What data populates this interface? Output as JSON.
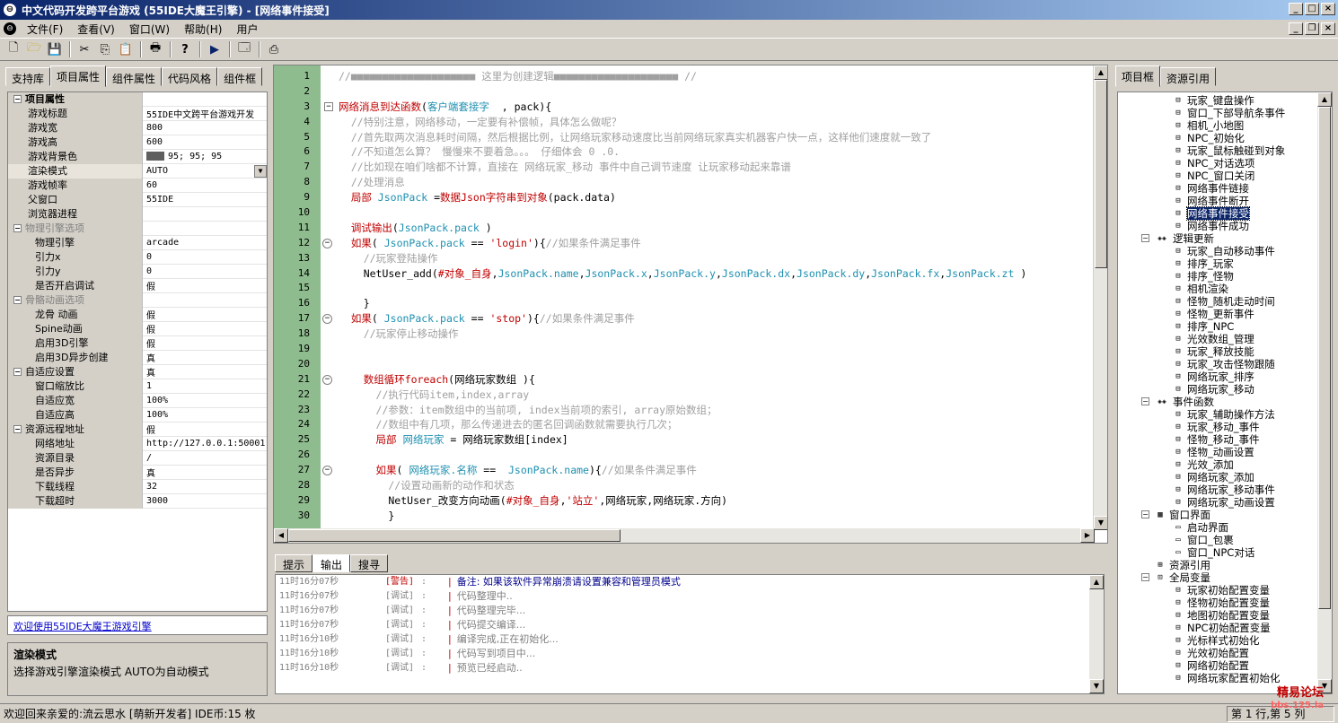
{
  "window": {
    "title": "中文代码开发跨平台游戏 (55IDE大魔王引擎) - [网络事件接受]"
  },
  "menu": [
    "文件(F)",
    "查看(V)",
    "窗口(W)",
    "帮助(H)",
    "用户"
  ],
  "left_panel": {
    "tabs": [
      "支持库",
      "项目属性",
      "组件属性",
      "代码风格",
      "组件框"
    ],
    "active_tab": 1,
    "properties": [
      {
        "name": "项目属性",
        "value": "",
        "kind": "category",
        "expanded": true
      },
      {
        "name": "游戏标题",
        "value": "55IDE中文跨平台游戏开发",
        "kind": "prop",
        "level": 1
      },
      {
        "name": "游戏宽",
        "value": "800",
        "kind": "prop",
        "level": 1
      },
      {
        "name": "游戏高",
        "value": "600",
        "kind": "prop",
        "level": 1
      },
      {
        "name": "游戏背景色",
        "value": "95; 95; 95",
        "kind": "color",
        "level": 1
      },
      {
        "name": "渲染模式",
        "value": "AUTO",
        "kind": "dropdown",
        "level": 1
      },
      {
        "name": "游戏帧率",
        "value": "60",
        "kind": "prop",
        "level": 1
      },
      {
        "name": "父窗口",
        "value": "55IDE",
        "kind": "prop",
        "level": 1
      },
      {
        "name": "浏览器进程",
        "value": "",
        "kind": "prop",
        "level": 1
      },
      {
        "name": "物理引擎选项",
        "value": "",
        "kind": "category-dim",
        "expanded": true
      },
      {
        "name": "物理引擎",
        "value": "arcade",
        "kind": "prop",
        "level": 2
      },
      {
        "name": "引力x",
        "value": "0",
        "kind": "prop",
        "level": 2
      },
      {
        "name": "引力y",
        "value": "0",
        "kind": "prop",
        "level": 2
      },
      {
        "name": "是否开启调试",
        "value": "假",
        "kind": "prop",
        "level": 2
      },
      {
        "name": "骨骼动画选项",
        "value": "",
        "kind": "category-dim",
        "expanded": true
      },
      {
        "name": "龙骨 动画",
        "value": "假",
        "kind": "prop",
        "level": 2
      },
      {
        "name": "Spine动画",
        "value": "假",
        "kind": "prop",
        "level": 2
      },
      {
        "name": "启用3D引擎",
        "value": "假",
        "kind": "prop",
        "level": 2
      },
      {
        "name": "启用3D异步创建",
        "value": "真",
        "kind": "prop",
        "level": 2
      },
      {
        "name": "自适应设置",
        "value": "真",
        "kind": "category-plain",
        "expanded": true
      },
      {
        "name": "窗口缩放比",
        "value": "1",
        "kind": "prop",
        "level": 2
      },
      {
        "name": "自适应宽",
        "value": "100%",
        "kind": "prop",
        "level": 2
      },
      {
        "name": "自适应高",
        "value": "100%",
        "kind": "prop",
        "level": 2
      },
      {
        "name": "资源远程地址",
        "value": "假",
        "kind": "category-plain",
        "expanded": true
      },
      {
        "name": "网络地址",
        "value": "http://127.0.0.1:50001",
        "kind": "prop",
        "level": 2
      },
      {
        "name": "资源目录",
        "value": "/",
        "kind": "prop",
        "level": 2
      },
      {
        "name": "是否异步",
        "value": "真",
        "kind": "prop",
        "level": 2
      },
      {
        "name": "下载线程",
        "value": "32",
        "kind": "prop",
        "level": 2
      },
      {
        "name": "下载超时",
        "value": "3000",
        "kind": "prop",
        "level": 2
      }
    ],
    "welcome_link": "欢迎使用55IDE大魔王游戏引擎",
    "desc_title": "渲染模式",
    "desc_text": "选择游戏引擎渲染模式 AUTO为自动模式"
  },
  "code_lines": [
    {
      "n": "1",
      "fold": "",
      "parts": [
        [
          "cm",
          "//■■■■■■■■■■■■■■■■■■■■ 这里为创建逻辑■■■■■■■■■■■■■■■■■■■■ //"
        ]
      ]
    },
    {
      "n": "2",
      "fold": "",
      "parts": []
    },
    {
      "n": "3",
      "fold": "box",
      "parts": [
        [
          "kw",
          "网络消息到达函数"
        ],
        [
          "tx",
          "("
        ],
        [
          "var",
          "客户端套接字"
        ],
        [
          "tx",
          "  , pack){"
        ]
      ]
    },
    {
      "n": "4",
      "fold": "",
      "parts": [
        [
          "cm",
          "  //特别注意，网络移动，一定要有补偿帧，具体怎么做呢？"
        ]
      ]
    },
    {
      "n": "5",
      "fold": "",
      "parts": [
        [
          "cm",
          "  //首先取两次消息耗时间隔，然后根据比例，让网络玩家移动速度比当前网络玩家真实机器客户快一点，这样他们速度就一致了"
        ]
      ]
    },
    {
      "n": "6",
      "fold": "",
      "parts": [
        [
          "cm",
          "  //不知道怎么算？ 慢慢来不要着急。。。 仔细体会 0 .0."
        ]
      ]
    },
    {
      "n": "7",
      "fold": "",
      "parts": [
        [
          "cm",
          "  //比如现在咱们啥都不计算，直接在 网络玩家_移动 事件中自己调节速度 让玩家移动起来靠谱"
        ]
      ]
    },
    {
      "n": "8",
      "fold": "",
      "parts": [
        [
          "cm",
          "  //处理消息"
        ]
      ]
    },
    {
      "n": "9",
      "fold": "",
      "parts": [
        [
          "tx",
          "  "
        ],
        [
          "kw",
          "局部"
        ],
        [
          "tx",
          " "
        ],
        [
          "var",
          "JsonPack"
        ],
        [
          "tx",
          " ="
        ],
        [
          "kw",
          "数据Json字符串到对象"
        ],
        [
          "tx",
          "(pack.data)"
        ]
      ]
    },
    {
      "n": "10",
      "fold": "",
      "parts": []
    },
    {
      "n": "11",
      "fold": "",
      "parts": [
        [
          "tx",
          "  "
        ],
        [
          "kw",
          "调试输出"
        ],
        [
          "tx",
          "("
        ],
        [
          "var",
          "JsonPack.pack"
        ],
        [
          "tx",
          " )"
        ]
      ]
    },
    {
      "n": "12",
      "fold": "circle",
      "parts": [
        [
          "tx",
          "  "
        ],
        [
          "kw",
          "如果"
        ],
        [
          "tx",
          "( "
        ],
        [
          "var",
          "JsonPack.pack"
        ],
        [
          "tx",
          " == "
        ],
        [
          "str",
          "'login'"
        ],
        [
          "tx",
          "){"
        ],
        [
          "cm",
          "//如果条件满足事件"
        ]
      ]
    },
    {
      "n": "13",
      "fold": "",
      "parts": [
        [
          "cm",
          "    //玩家登陆操作"
        ]
      ]
    },
    {
      "n": "14",
      "fold": "",
      "parts": [
        [
          "tx",
          "    NetUser_add("
        ],
        [
          "kw",
          "#对象_自身"
        ],
        [
          "tx",
          ","
        ],
        [
          "var",
          "JsonPack.name"
        ],
        [
          "tx",
          ","
        ],
        [
          "var",
          "JsonPack.x"
        ],
        [
          "tx",
          ","
        ],
        [
          "var",
          "JsonPack.y"
        ],
        [
          "tx",
          ","
        ],
        [
          "var",
          "JsonPack.dx"
        ],
        [
          "tx",
          ","
        ],
        [
          "var",
          "JsonPack.dy"
        ],
        [
          "tx",
          ","
        ],
        [
          "var",
          "JsonPack.fx"
        ],
        [
          "tx",
          ","
        ],
        [
          "var",
          "JsonPack.zt"
        ],
        [
          "tx",
          " )"
        ]
      ]
    },
    {
      "n": "15",
      "fold": "",
      "parts": []
    },
    {
      "n": "16",
      "fold": "",
      "parts": [
        [
          "tx",
          "    }"
        ]
      ]
    },
    {
      "n": "17",
      "fold": "circle",
      "parts": [
        [
          "tx",
          "  "
        ],
        [
          "kw",
          "如果"
        ],
        [
          "tx",
          "( "
        ],
        [
          "var",
          "JsonPack.pack"
        ],
        [
          "tx",
          " == "
        ],
        [
          "str",
          "'stop'"
        ],
        [
          "tx",
          "){"
        ],
        [
          "cm",
          "//如果条件满足事件"
        ]
      ]
    },
    {
      "n": "18",
      "fold": "",
      "parts": [
        [
          "cm",
          "    //玩家停止移动操作"
        ]
      ]
    },
    {
      "n": "19",
      "fold": "",
      "parts": []
    },
    {
      "n": "20",
      "fold": "",
      "parts": []
    },
    {
      "n": "21",
      "fold": "circle",
      "parts": [
        [
          "tx",
          "    "
        ],
        [
          "kw",
          "数组循环foreach"
        ],
        [
          "tx",
          "(网络玩家数组 ){"
        ]
      ]
    },
    {
      "n": "22",
      "fold": "",
      "parts": [
        [
          "cm",
          "      //执行代码item,index,array"
        ]
      ]
    },
    {
      "n": "23",
      "fold": "",
      "parts": [
        [
          "cm",
          "      //参数：item数组中的当前项, index当前项的索引, array原始数组；"
        ]
      ]
    },
    {
      "n": "24",
      "fold": "",
      "parts": [
        [
          "cm",
          "      //数组中有几项，那么传递进去的匿名回调函数就需要执行几次；"
        ]
      ]
    },
    {
      "n": "25",
      "fold": "",
      "parts": [
        [
          "tx",
          "      "
        ],
        [
          "kw",
          "局部"
        ],
        [
          "tx",
          " "
        ],
        [
          "var",
          "网络玩家"
        ],
        [
          "tx",
          " = 网络玩家数组[index]"
        ]
      ]
    },
    {
      "n": "26",
      "fold": "",
      "parts": []
    },
    {
      "n": "27",
      "fold": "circle",
      "parts": [
        [
          "tx",
          "      "
        ],
        [
          "kw",
          "如果"
        ],
        [
          "tx",
          "( "
        ],
        [
          "var",
          "网络玩家.名称"
        ],
        [
          "tx",
          " ==  "
        ],
        [
          "var",
          "JsonPack.name"
        ],
        [
          "tx",
          "){"
        ],
        [
          "cm",
          "//如果条件满足事件"
        ]
      ]
    },
    {
      "n": "28",
      "fold": "",
      "parts": [
        [
          "cm",
          "        //设置动画新的动作和状态"
        ]
      ]
    },
    {
      "n": "29",
      "fold": "",
      "parts": [
        [
          "tx",
          "        NetUser_改变方向动画("
        ],
        [
          "kw",
          "#对象_自身"
        ],
        [
          "tx",
          ","
        ],
        [
          "str",
          "'站立'"
        ],
        [
          "tx",
          ",网络玩家,网络玩家.方向)"
        ]
      ]
    },
    {
      "n": "30",
      "fold": "",
      "parts": [
        [
          "tx",
          "        }"
        ]
      ]
    }
  ],
  "output_tabs": [
    "提示",
    "输出",
    "搜寻"
  ],
  "output_active": 1,
  "output_lines": [
    {
      "ts": "11时16分07秒",
      "tag": "[警告]",
      "sep": " :",
      "msg": "备注: 如果该软件异常崩溃请设置兼容和管理员模式",
      "level": "warn"
    },
    {
      "ts": "11时16分07秒",
      "tag": "[调试]",
      "sep": " :",
      "msg": "代码整理中..",
      "level": "debug"
    },
    {
      "ts": "11时16分07秒",
      "tag": "[调试]",
      "sep": " :",
      "msg": "代码整理完毕...",
      "level": "debug"
    },
    {
      "ts": "11时16分07秒",
      "tag": "[调试]",
      "sep": " :",
      "msg": "代码提交编译...",
      "level": "debug"
    },
    {
      "ts": "11时16分10秒",
      "tag": "[调试]",
      "sep": " :",
      "msg": "编译完成,正在初始化...",
      "level": "debug"
    },
    {
      "ts": "11时16分10秒",
      "tag": "[调试]",
      "sep": " :",
      "msg": "代码写到项目中...",
      "level": "debug"
    },
    {
      "ts": "11时16分10秒",
      "tag": "[调试]",
      "sep": " :",
      "msg": "预览已经启动..",
      "level": "debug"
    }
  ],
  "right_panel": {
    "tabs": [
      "项目框",
      "资源引用"
    ],
    "active_tab": 0,
    "tree": [
      {
        "label": "玩家_键盘操作",
        "depth": 3,
        "icon": "leaf"
      },
      {
        "label": "窗口_下部导航条事件",
        "depth": 3,
        "icon": "leaf"
      },
      {
        "label": "相机_小地图",
        "depth": 3,
        "icon": "leaf"
      },
      {
        "label": "NPC_初始化",
        "depth": 3,
        "icon": "leaf"
      },
      {
        "label": "玩家_鼠标触碰到对象",
        "depth": 3,
        "icon": "leaf"
      },
      {
        "label": "NPC_对话选项",
        "depth": 3,
        "icon": "leaf"
      },
      {
        "label": "NPC_窗口关闭",
        "depth": 3,
        "icon": "leaf"
      },
      {
        "label": "网络事件链接",
        "depth": 3,
        "icon": "leaf"
      },
      {
        "label": "网络事件断开",
        "depth": 3,
        "icon": "leaf"
      },
      {
        "label": "网络事件接受",
        "depth": 3,
        "icon": "leaf",
        "selected": true
      },
      {
        "label": "网络事件成功",
        "depth": 3,
        "icon": "leaf"
      },
      {
        "label": "逻辑更新",
        "depth": 2,
        "icon": "folder",
        "expander": "minus"
      },
      {
        "label": "玩家_自动移动事件",
        "depth": 3,
        "icon": "leaf"
      },
      {
        "label": "排序_玩家",
        "depth": 3,
        "icon": "leaf"
      },
      {
        "label": "排序_怪物",
        "depth": 3,
        "icon": "leaf"
      },
      {
        "label": "相机渲染",
        "depth": 3,
        "icon": "leaf"
      },
      {
        "label": "怪物_随机走动时间",
        "depth": 3,
        "icon": "leaf"
      },
      {
        "label": "怪物_更新事件",
        "depth": 3,
        "icon": "leaf"
      },
      {
        "label": "排序_NPC",
        "depth": 3,
        "icon": "leaf"
      },
      {
        "label": "光效数组_管理",
        "depth": 3,
        "icon": "leaf"
      },
      {
        "label": "玩家_释放技能",
        "depth": 3,
        "icon": "leaf"
      },
      {
        "label": "玩家_攻击怪物跟随",
        "depth": 3,
        "icon": "leaf"
      },
      {
        "label": "网络玩家_排序",
        "depth": 3,
        "icon": "leaf"
      },
      {
        "label": "网络玩家_移动",
        "depth": 3,
        "icon": "leaf"
      },
      {
        "label": "事件函数",
        "depth": 2,
        "icon": "folder",
        "expander": "minus"
      },
      {
        "label": "玩家_辅助操作方法",
        "depth": 3,
        "icon": "leaf"
      },
      {
        "label": "玩家_移动_事件",
        "depth": 3,
        "icon": "leaf"
      },
      {
        "label": "怪物_移动_事件",
        "depth": 3,
        "icon": "leaf"
      },
      {
        "label": "怪物_动画设置",
        "depth": 3,
        "icon": "leaf"
      },
      {
        "label": "光效_添加",
        "depth": 3,
        "icon": "leaf"
      },
      {
        "label": "网络玩家_添加",
        "depth": 3,
        "icon": "leaf"
      },
      {
        "label": "网络玩家_移动事件",
        "depth": 3,
        "icon": "leaf"
      },
      {
        "label": "网络玩家_动画设置",
        "depth": 3,
        "icon": "leaf"
      },
      {
        "label": "窗口界面",
        "depth": 2,
        "icon": "window-group",
        "expander": "minus"
      },
      {
        "label": "启动界面",
        "depth": 3,
        "icon": "window"
      },
      {
        "label": "窗口_包裹",
        "depth": 3,
        "icon": "window"
      },
      {
        "label": "窗口_NPC对话",
        "depth": 3,
        "icon": "window"
      },
      {
        "label": "资源引用",
        "depth": 2,
        "icon": "resource"
      },
      {
        "label": "全局变量",
        "depth": 2,
        "icon": "vars",
        "expander": "minus"
      },
      {
        "label": "玩家初始配置变量",
        "depth": 3,
        "icon": "leaf"
      },
      {
        "label": "怪物初始配置变量",
        "depth": 3,
        "icon": "leaf"
      },
      {
        "label": "地图初始配置变量",
        "depth": 3,
        "icon": "leaf"
      },
      {
        "label": "NPC初始配置变量",
        "depth": 3,
        "icon": "leaf"
      },
      {
        "label": "光标样式初始化",
        "depth": 3,
        "icon": "leaf"
      },
      {
        "label": "光效初始配置",
        "depth": 3,
        "icon": "leaf"
      },
      {
        "label": "网络初始配置",
        "depth": 3,
        "icon": "leaf"
      },
      {
        "label": "网络玩家配置初始化",
        "depth": 3,
        "icon": "leaf"
      }
    ]
  },
  "status": {
    "left": "欢迎回来亲爱的:流云思水 [萌新开发者] IDE币:15 枚",
    "position": "第 1 行,第 5 列"
  },
  "watermark": {
    "line1": "精易论坛",
    "line2": "bbs.125.la"
  }
}
